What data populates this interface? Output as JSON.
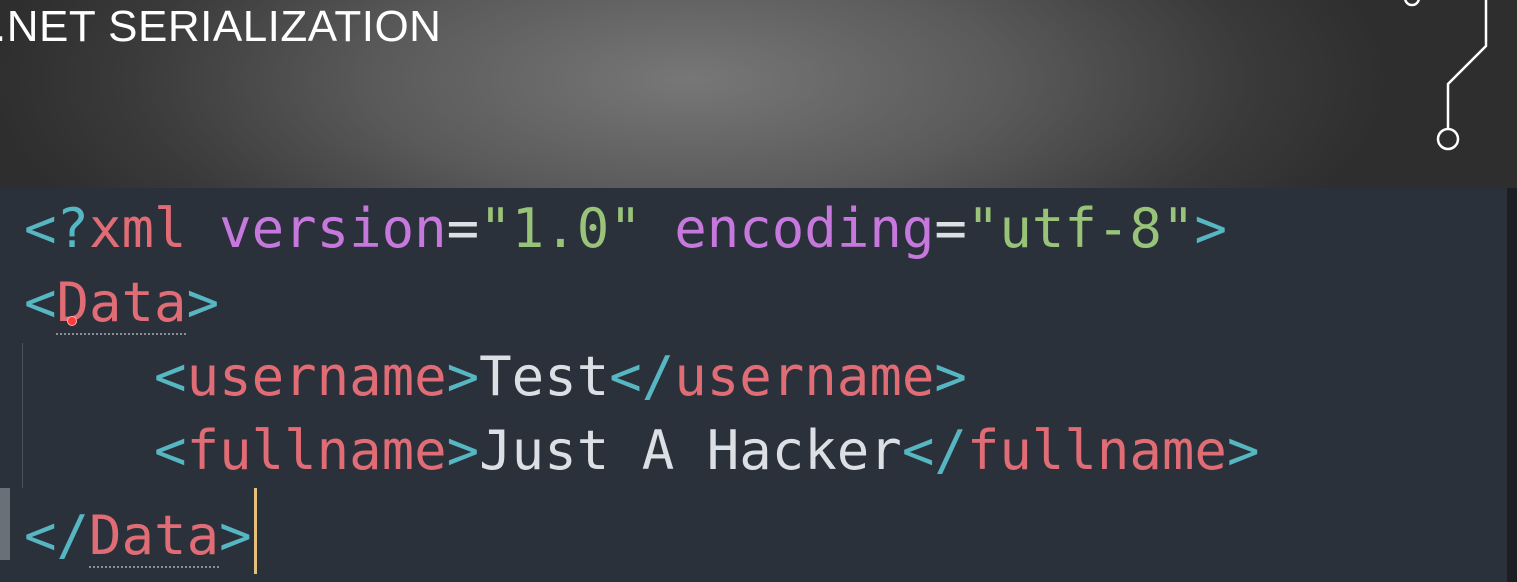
{
  "slide": {
    "title": ".NET SERIALIZATION"
  },
  "code": {
    "line1": {
      "open": "<?",
      "kw": "xml",
      "attr1_name": "version",
      "eq1": "=",
      "attr1_value": "\"1.0\"",
      "attr2_name": "encoding",
      "eq2": "=",
      "attr2_value": "\"utf-8\"",
      "close": ">"
    },
    "line2": {
      "open": "<",
      "tag": "Data",
      "close": ">"
    },
    "line3": {
      "indent": "    ",
      "open": "<",
      "tag": "username",
      "close": ">",
      "text": "Test",
      "end_open": "</",
      "end_tag": "username",
      "end_close": ">"
    },
    "line4": {
      "indent": "    ",
      "open": "<",
      "tag": "fullname",
      "close": ">",
      "text": "Just A Hacker",
      "end_open": "</",
      "end_tag": "fullname",
      "end_close": ">"
    },
    "line5": {
      "open": "</",
      "tag": "Data",
      "close": ">"
    }
  },
  "colors": {
    "punctuation": "#56b6c2",
    "tag": "#e06c75",
    "attribute": "#c678dd",
    "value": "#98c379",
    "text": "#dcdfe4",
    "cursor": "#e5c07b",
    "editor_bg": "#2b313a"
  },
  "icons": {
    "decoration": "circuit-line-decoration"
  }
}
